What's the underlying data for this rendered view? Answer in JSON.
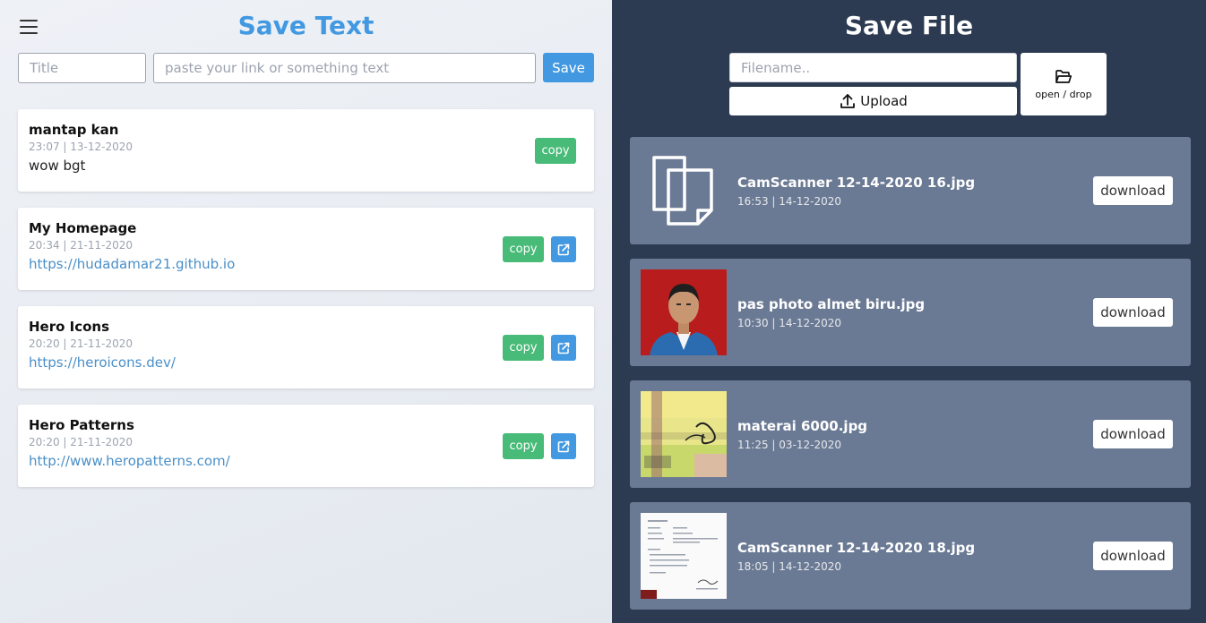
{
  "text_panel": {
    "title": "Save Text",
    "title_placeholder": "Title",
    "text_placeholder": "paste your link or something text",
    "save_label": "Save",
    "copy_label": "copy",
    "items": [
      {
        "title": "mantap kan",
        "time": "23:07 | 13-12-2020",
        "content": "wow bgt",
        "is_link": false
      },
      {
        "title": "My Homepage",
        "time": "20:34 | 21-11-2020",
        "content": "https://hudadamar21.github.io",
        "is_link": true
      },
      {
        "title": "Hero Icons",
        "time": "20:20 | 21-11-2020",
        "content": "https://heroicons.dev/",
        "is_link": true
      },
      {
        "title": "Hero Patterns",
        "time": "20:20 | 21-11-2020",
        "content": "http://www.heropatterns.com/",
        "is_link": true
      }
    ]
  },
  "file_panel": {
    "title": "Save File",
    "filename_placeholder": "Filename..",
    "upload_label": "Upload",
    "drop_label": "open / drop",
    "download_label": "download",
    "files": [
      {
        "name": "CamScanner 12-14-2020 16.jpg",
        "time": "16:53 | 14-12-2020",
        "thumb": "document-icon"
      },
      {
        "name": "pas photo almet biru.jpg",
        "time": "10:30 | 14-12-2020",
        "thumb": "portrait-photo"
      },
      {
        "name": "materai 6000.jpg",
        "time": "11:25 | 03-12-2020",
        "thumb": "stamp-photo"
      },
      {
        "name": "CamScanner 12-14-2020 18.jpg",
        "time": "18:05 | 14-12-2020",
        "thumb": "scanned-document"
      }
    ]
  },
  "colors": {
    "accent_blue": "#4299e1",
    "copy_green": "#48bb78",
    "right_bg": "#2d3b52",
    "file_row_bg": "#6b7a94"
  }
}
